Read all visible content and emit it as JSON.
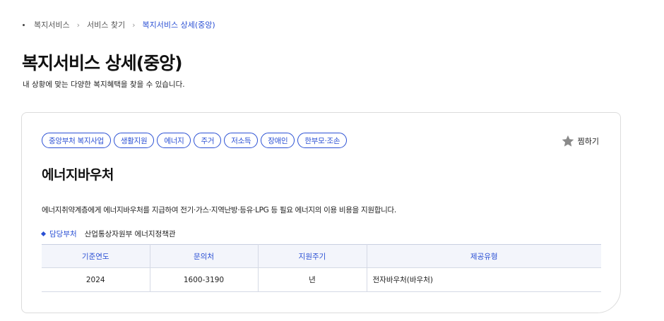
{
  "breadcrumb": {
    "items": [
      "복지서비스",
      "서비스 찾기",
      "복지서비스 상세(중앙)"
    ]
  },
  "page": {
    "title": "복지서비스 상세(중앙)",
    "description": "내 상황에 맞는 다양한 복지혜택을 찾을 수 있습니다."
  },
  "service": {
    "tags": [
      "중앙부처 복지사업",
      "생활지원",
      "에너지",
      "주거",
      "저소득",
      "장애인",
      "한부모·조손"
    ],
    "favorite_label": "찜하기",
    "title": "에너지바우처",
    "description": "에너지취약계층에게 에너지바우처를 지급하여 전기·가스·지역난방·등유·LPG 등 필요 에너지의 이용 비용을 지원합니다.",
    "department_label": "담당부처",
    "department": "산업통상자원부 에너지정책관",
    "table": {
      "headers": [
        "기준연도",
        "문의처",
        "지원주기",
        "제공유형"
      ],
      "row": [
        "2024",
        "1600-3190",
        "년",
        "전자바우처(바우처)"
      ]
    }
  },
  "colors": {
    "accent": "#2b50d4",
    "table_header_bg": "#f3f5fb",
    "star": "#8a8a8a"
  },
  "icons": {
    "favorite": "star-icon",
    "department_bullet": "diamond-icon"
  }
}
